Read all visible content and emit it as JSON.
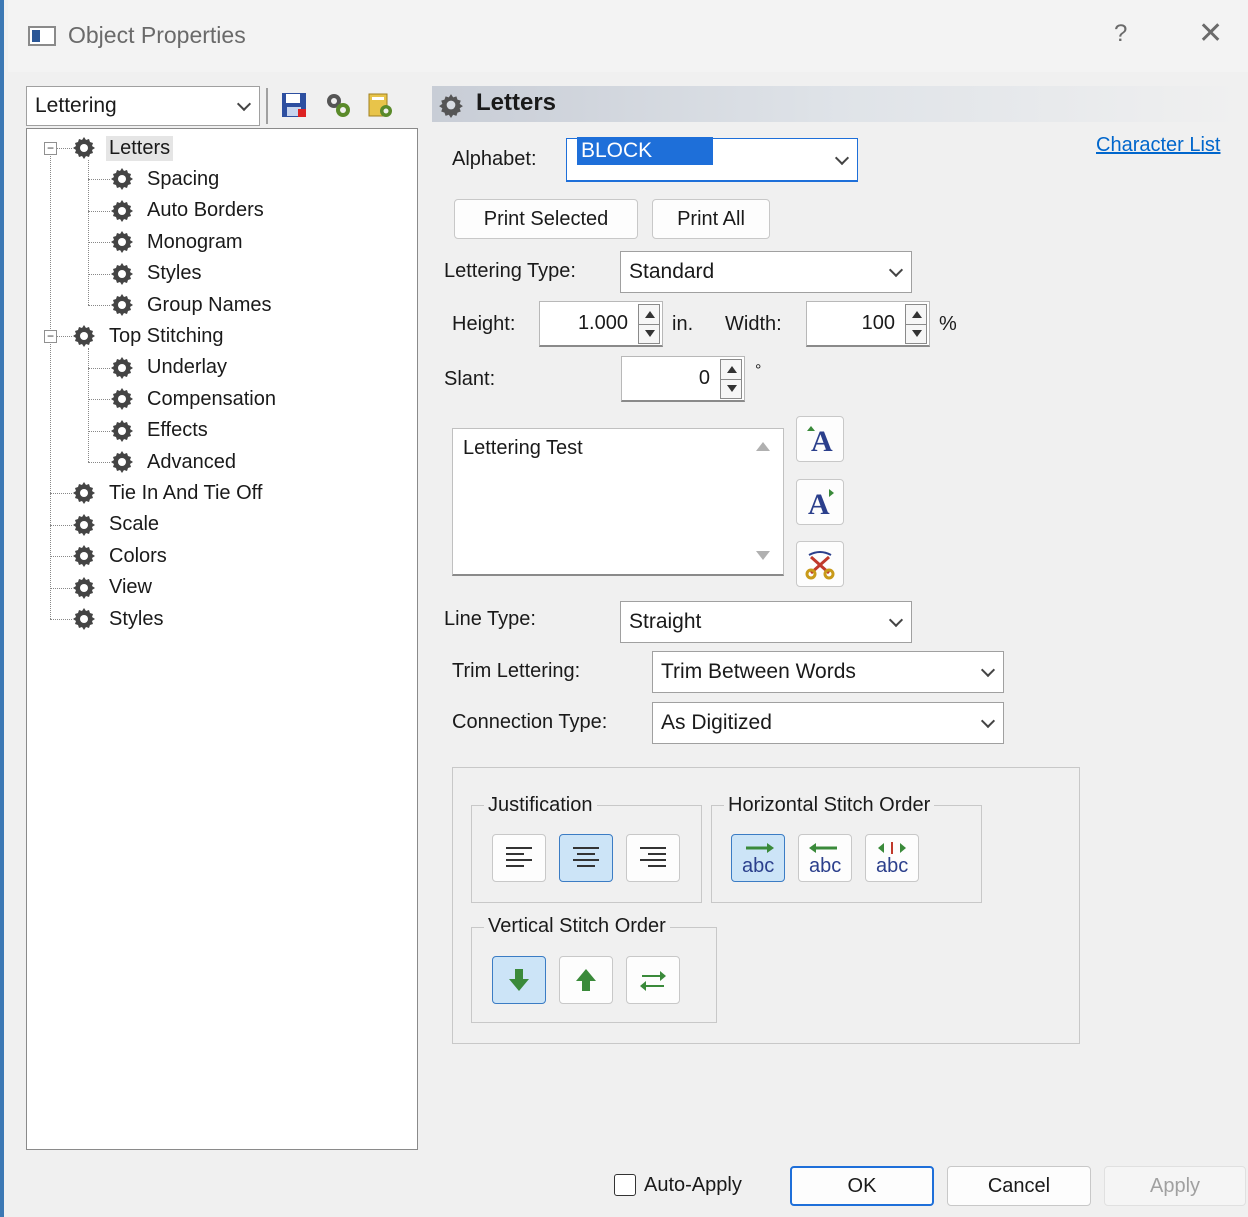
{
  "window": {
    "title": "Object Properties",
    "help": "?",
    "close": "✕"
  },
  "left": {
    "combo_value": "Lettering",
    "tree": [
      {
        "label": "Letters",
        "level": 0,
        "expander": "−",
        "selected": true
      },
      {
        "label": "Spacing",
        "level": 1
      },
      {
        "label": "Auto Borders",
        "level": 1
      },
      {
        "label": "Monogram",
        "level": 1
      },
      {
        "label": "Styles",
        "level": 1
      },
      {
        "label": "Group Names",
        "level": 1
      },
      {
        "label": "Top Stitching",
        "level": 0,
        "expander": "−"
      },
      {
        "label": "Underlay",
        "level": 1
      },
      {
        "label": "Compensation",
        "level": 1
      },
      {
        "label": "Effects",
        "level": 1
      },
      {
        "label": "Advanced",
        "level": 1
      },
      {
        "label": "Tie In And Tie Off",
        "level": 0
      },
      {
        "label": "Scale",
        "level": 0
      },
      {
        "label": "Colors",
        "level": 0
      },
      {
        "label": "View",
        "level": 0
      },
      {
        "label": "Styles",
        "level": 0
      }
    ]
  },
  "panel": {
    "title": "Letters",
    "character_list": "Character List",
    "alphabet_label": "Alphabet:",
    "alphabet_value": "BLOCK",
    "print_selected": "Print Selected",
    "print_all": "Print All",
    "lettering_type_label": "Lettering Type:",
    "lettering_type_value": "Standard",
    "height_label": "Height:",
    "height_value": "1.000",
    "height_unit": "in.",
    "width_label": "Width:",
    "width_value": "100",
    "width_unit": "%",
    "slant_label": "Slant:",
    "slant_value": "0",
    "slant_unit": "°",
    "text_value": "Lettering Test",
    "line_type_label": "Line Type:",
    "line_type_value": "Straight",
    "trim_label": "Trim Lettering:",
    "trim_value": "Trim Between Words",
    "connection_label": "Connection Type:",
    "connection_value": "As Digitized",
    "justification_label": "Justification",
    "horizontal_order_label": "Horizontal Stitch Order",
    "vertical_order_label": "Vertical Stitch Order",
    "abc": "abc"
  },
  "footer": {
    "auto_apply": "Auto-Apply",
    "ok": "OK",
    "cancel": "Cancel",
    "apply": "Apply"
  },
  "colors": {
    "accent": "#0066cc",
    "selected_bg": "#cce4f7",
    "selected_border": "#3b7cc4",
    "selection_highlight": "#1e6fd9"
  }
}
